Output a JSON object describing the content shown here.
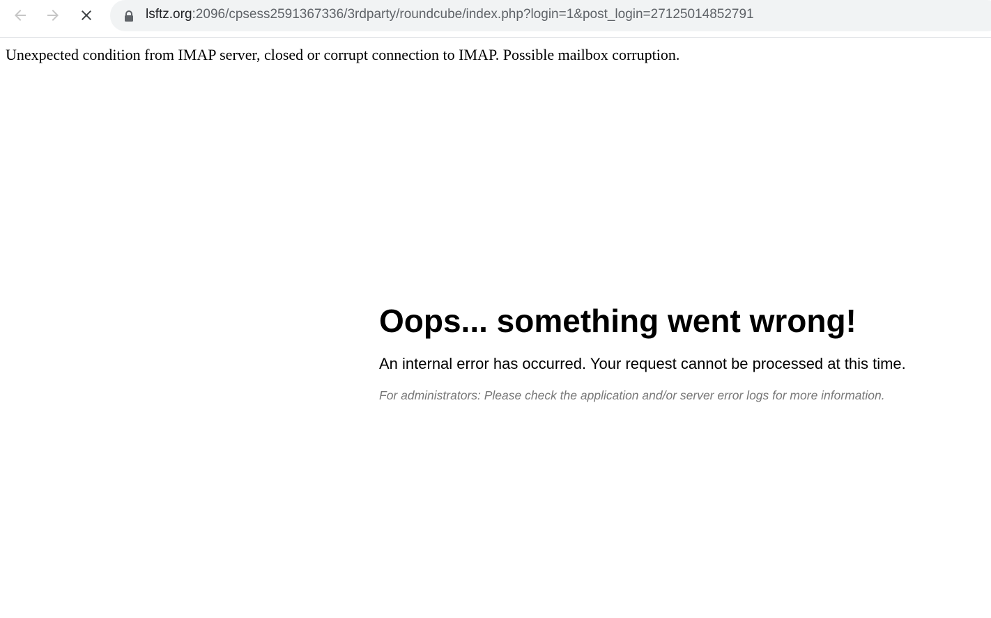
{
  "browser": {
    "url_host": "lsftz.org",
    "url_rest": ":2096/cpsess2591367336/3rdparty/roundcube/index.php?login=1&post_login=27125014852791",
    "icons": {
      "back": "arrow-left-icon",
      "forward": "arrow-right-icon",
      "stop": "close-icon",
      "secure": "lock-icon"
    }
  },
  "page": {
    "imap_warning": "Unexpected condition from IMAP server, closed or corrupt connection to IMAP. Possible mailbox corruption.",
    "error": {
      "title": "Oops... something went wrong!",
      "message": "An internal error has occurred. Your request cannot be processed at this time.",
      "hint": "For administrators: Please check the application and/or server error logs for more information."
    }
  }
}
